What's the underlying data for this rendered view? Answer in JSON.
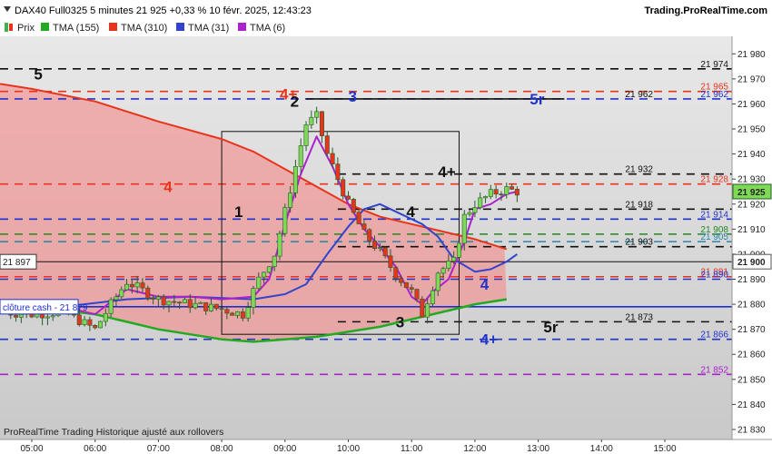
{
  "header": {
    "title": "DAX40 Full0325 5 minutes 21 925 +0,33 % 10 févr. 2025, 12:43:23",
    "site": "Trading.ProRealTime.com"
  },
  "legend": [
    {
      "label": "Prix",
      "color": "#3cb44b",
      "icon": "candle-icon"
    },
    {
      "label": "TMA (155)",
      "color": "#22aa22",
      "icon": "line-swatch-icon"
    },
    {
      "label": "TMA (310)",
      "color": "#e8341c",
      "icon": "line-swatch-icon"
    },
    {
      "label": "TMA (31)",
      "color": "#3344cc",
      "icon": "line-swatch-icon"
    },
    {
      "label": "TMA (6)",
      "color": "#aa22cc",
      "icon": "line-swatch-icon"
    }
  ],
  "footer": "ProRealTime Trading  Historique ajusté aux rollovers",
  "chart_data": {
    "type": "candlestick",
    "instrument": "DAX40 Full0325",
    "timeframe": "5 minutes",
    "x_ticks": [
      "05:00",
      "06:00",
      "07:00",
      "08:00",
      "09:00",
      "10:00",
      "11:00",
      "12:00",
      "13:00",
      "14:00",
      "15:00"
    ],
    "y_ticks": [
      21830,
      21840,
      21850,
      21860,
      21870,
      21880,
      21890,
      21900,
      21910,
      21920,
      21930,
      21940,
      21950,
      21960,
      21970,
      21980
    ],
    "y_tick_labels": [
      "21 830",
      "21 840",
      "21 850",
      "21 860",
      "21 870",
      "21 880",
      "21 890",
      "21 900",
      "21 910",
      "21 920",
      "21 930",
      "21 940",
      "21 950",
      "21 960",
      "21 970",
      "21 980"
    ],
    "ylim": [
      21826,
      21987
    ],
    "last_price": {
      "value": 21925,
      "label": "21 925"
    },
    "close_line": {
      "value": 21897,
      "label": "21 897"
    },
    "cash_close": {
      "value": 21879,
      "label": "clôture cash -  21 879"
    },
    "levels": [
      {
        "value": 21974,
        "label": "21 974",
        "color": "#111111",
        "dash": "dash"
      },
      {
        "value": 21965,
        "label": "21 965",
        "color": "#e8341c",
        "dash": "dash"
      },
      {
        "value": 21962,
        "label": "21 962",
        "color": "#2233cc",
        "dash": "dash"
      },
      {
        "value": 21962,
        "label": "21 962",
        "color": "#111111",
        "dash": "solid",
        "start_time": "09:20"
      },
      {
        "value": 21932,
        "label": "21 932",
        "color": "#111111",
        "dash": "dash",
        "start_time": "09:50"
      },
      {
        "value": 21928,
        "label": "21 928",
        "color": "#e8341c",
        "dash": "dash"
      },
      {
        "value": 21918,
        "label": "21 918",
        "color": "#111111",
        "dash": "dash",
        "start_time": "09:50"
      },
      {
        "value": 21914,
        "label": "21 914",
        "color": "#2233cc",
        "dash": "dash"
      },
      {
        "value": 21908,
        "label": "21 908",
        "color": "#228822",
        "dash": "dash"
      },
      {
        "value": 21905,
        "label": "21 905",
        "color": "#2288aa",
        "dash": "dash"
      },
      {
        "value": 21903,
        "label": "21 903",
        "color": "#111111",
        "dash": "dash",
        "start_time": "09:50"
      },
      {
        "value": 21891,
        "label": "21 891",
        "color": "#e8341c",
        "dash": "dash"
      },
      {
        "value": 21890,
        "label": "21 890",
        "color": "#2233cc",
        "dash": "dash"
      },
      {
        "value": 21873,
        "label": "21 873",
        "color": "#111111",
        "dash": "dash",
        "start_time": "09:50"
      },
      {
        "value": 21866,
        "label": "21 866",
        "color": "#2233cc",
        "dash": "dash"
      },
      {
        "value": 21852,
        "label": "21 852",
        "color": "#aa22cc",
        "dash": "dash"
      }
    ],
    "box": {
      "t0": "08:00",
      "t1": "11:45",
      "high": 21949,
      "low": 21868
    },
    "annotations": [
      {
        "text": "5",
        "time": "05:02",
        "value": 21972,
        "color": "#111111"
      },
      {
        "text": "4+",
        "time": "08:55",
        "value": 21964,
        "color": "#e8341c"
      },
      {
        "text": "2",
        "time": "09:05",
        "value": 21961,
        "color": "#111111"
      },
      {
        "text": "3",
        "time": "10:00",
        "value": 21963,
        "color": "#2233cc"
      },
      {
        "text": "5r",
        "time": "12:52",
        "value": 21962,
        "color": "#2233cc"
      },
      {
        "text": "4",
        "time": "07:05",
        "value": 21927,
        "color": "#e8341c"
      },
      {
        "text": "4+",
        "time": "11:25",
        "value": 21933,
        "color": "#111111"
      },
      {
        "text": "1",
        "time": "08:12",
        "value": 21917,
        "color": "#111111"
      },
      {
        "text": "4",
        "time": "10:55",
        "value": 21917,
        "color": "#111111"
      },
      {
        "text": "4",
        "time": "12:05",
        "value": 21888,
        "color": "#2233cc"
      },
      {
        "text": "3",
        "time": "10:45",
        "value": 21873,
        "color": "#111111"
      },
      {
        "text": "5r",
        "time": "13:05",
        "value": 21871,
        "color": "#111111"
      },
      {
        "text": "4+",
        "time": "12:05",
        "value": 21866,
        "color": "#2233cc"
      }
    ],
    "series": [
      {
        "name": "TMA (310)",
        "color": "#e8341c",
        "width": 2,
        "points": [
          [
            "04:30",
            21968
          ],
          [
            "05:00",
            21966
          ],
          [
            "06:00",
            21961
          ],
          [
            "07:00",
            21953
          ],
          [
            "08:00",
            21946
          ],
          [
            "08:30",
            21941
          ],
          [
            "09:00",
            21934
          ],
          [
            "09:30",
            21927
          ],
          [
            "10:00",
            21920
          ],
          [
            "10:30",
            21915
          ],
          [
            "11:00",
            21912
          ],
          [
            "11:30",
            21909
          ],
          [
            "12:00",
            21906
          ],
          [
            "12:30",
            21902
          ]
        ]
      },
      {
        "name": "TMA (155)",
        "color": "#22aa22",
        "width": 2.5,
        "points": [
          [
            "04:30",
            21880
          ],
          [
            "05:00",
            21879
          ],
          [
            "06:00",
            21876
          ],
          [
            "06:30",
            21873
          ],
          [
            "07:00",
            21870
          ],
          [
            "07:30",
            21868
          ],
          [
            "08:00",
            21866
          ],
          [
            "08:30",
            21865
          ],
          [
            "09:00",
            21866
          ],
          [
            "09:30",
            21867
          ],
          [
            "10:00",
            21869
          ],
          [
            "10:30",
            21871
          ],
          [
            "11:00",
            21874
          ],
          [
            "11:30",
            21877
          ],
          [
            "12:00",
            21880
          ],
          [
            "12:30",
            21882
          ]
        ]
      },
      {
        "name": "TMA (31)",
        "color": "#3344cc",
        "width": 2,
        "points": [
          [
            "04:30",
            21878
          ],
          [
            "05:30",
            21879
          ],
          [
            "06:30",
            21882
          ],
          [
            "07:30",
            21883
          ],
          [
            "08:30",
            21882
          ],
          [
            "09:00",
            21884
          ],
          [
            "09:20",
            21888
          ],
          [
            "09:40",
            21900
          ],
          [
            "10:00",
            21911
          ],
          [
            "10:15",
            21918
          ],
          [
            "10:30",
            21920
          ],
          [
            "10:50",
            21916
          ],
          [
            "11:10",
            21912
          ],
          [
            "11:25",
            21907
          ],
          [
            "11:40",
            21898
          ],
          [
            "12:00",
            21893
          ],
          [
            "12:15",
            21894
          ],
          [
            "12:30",
            21897
          ],
          [
            "12:40",
            21900
          ]
        ]
      },
      {
        "name": "TMA (6)",
        "color": "#aa22cc",
        "width": 2,
        "points": [
          [
            "04:30",
            21877
          ],
          [
            "05:30",
            21879
          ],
          [
            "06:00",
            21876
          ],
          [
            "06:30",
            21886
          ],
          [
            "07:00",
            21883
          ],
          [
            "07:30",
            21883
          ],
          [
            "08:00",
            21882
          ],
          [
            "08:30",
            21883
          ],
          [
            "08:45",
            21890
          ],
          [
            "09:00",
            21912
          ],
          [
            "09:15",
            21932
          ],
          [
            "09:30",
            21947
          ],
          [
            "09:45",
            21935
          ],
          [
            "10:00",
            21920
          ],
          [
            "10:15",
            21910
          ],
          [
            "10:30",
            21903
          ],
          [
            "10:45",
            21895
          ],
          [
            "11:00",
            21883
          ],
          [
            "11:10",
            21880
          ],
          [
            "11:20",
            21885
          ],
          [
            "11:35",
            21890
          ],
          [
            "11:50",
            21905
          ],
          [
            "12:00",
            21918
          ],
          [
            "12:15",
            21920
          ],
          [
            "12:30",
            21924
          ],
          [
            "12:40",
            21925
          ]
        ]
      },
      {
        "name": "Prix",
        "color": "#3cb44b",
        "width": 1,
        "points": [
          [
            "04:30",
            21877
          ],
          [
            "05:00",
            21876
          ],
          [
            "05:30",
            21877
          ],
          [
            "06:00",
            21870
          ],
          [
            "06:15",
            21880
          ],
          [
            "06:30",
            21889
          ],
          [
            "07:00",
            21882
          ],
          [
            "07:30",
            21880
          ],
          [
            "08:00",
            21878
          ],
          [
            "08:20",
            21876
          ],
          [
            "08:35",
            21890
          ],
          [
            "08:50",
            21900
          ],
          [
            "09:00",
            21917
          ],
          [
            "09:10",
            21935
          ],
          [
            "09:20",
            21952
          ],
          [
            "09:30",
            21955
          ],
          [
            "09:40",
            21940
          ],
          [
            "09:50",
            21930
          ],
          [
            "10:00",
            21920
          ],
          [
            "10:15",
            21908
          ],
          [
            "10:30",
            21901
          ],
          [
            "10:45",
            21892
          ],
          [
            "11:00",
            21885
          ],
          [
            "11:10",
            21876
          ],
          [
            "11:25",
            21893
          ],
          [
            "11:40",
            21897
          ],
          [
            "11:50",
            21915
          ],
          [
            "12:00",
            21920
          ],
          [
            "12:15",
            21924
          ],
          [
            "12:30",
            21926
          ],
          [
            "12:40",
            21925
          ]
        ]
      }
    ]
  }
}
